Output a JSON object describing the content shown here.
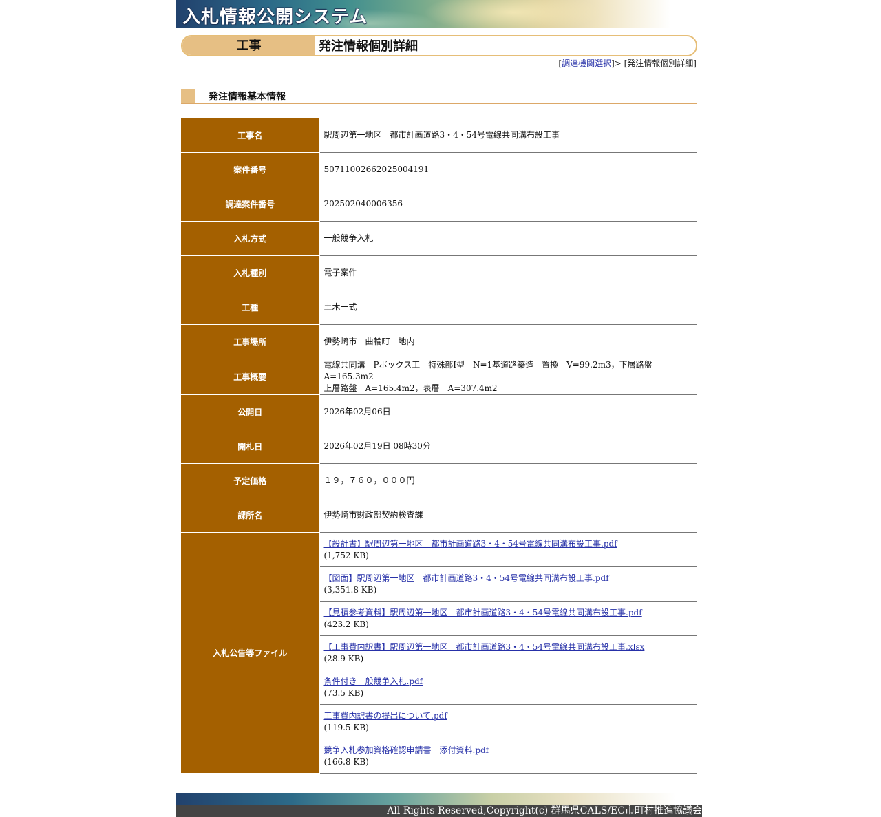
{
  "banner": {
    "title": "入札情報公開システム"
  },
  "heading": {
    "category": "工事",
    "title": "発注情報個別詳細"
  },
  "breadcrumb": {
    "open": "[",
    "link": "調達機関選択",
    "sep": "]> [発注情報個別詳細]"
  },
  "section": {
    "title": "発注情報基本情報"
  },
  "rows": [
    {
      "label": "工事名",
      "value": "駅周辺第一地区　都市計画道路3・4・54号電線共同溝布設工事"
    },
    {
      "label": "案件番号",
      "value": "50711002662025004191"
    },
    {
      "label": "調達案件番号",
      "value": "202502040006356"
    },
    {
      "label": "入札方式",
      "value": "一般競争入札"
    },
    {
      "label": "入札種別",
      "value": "電子案件"
    },
    {
      "label": "工種",
      "value": "土木一式"
    },
    {
      "label": "工事場所",
      "value": "伊勢崎市　曲輪町　地内"
    },
    {
      "label": "工事概要",
      "line1": "電線共同溝　Pボックス工　特殊部I型　N=1基道路築造　置換　V=99.2m3，下層路盤　A=165.3m2",
      "line2": "上層路盤　A=165.4m2，表層　A=307.4m2"
    },
    {
      "label": "公開日",
      "value": "2026年02月06日"
    },
    {
      "label": "開札日",
      "value": "2026年02月19日 08時30分"
    },
    {
      "label": "予定価格",
      "value": "１９，７６０，０００円"
    },
    {
      "label": "課所名",
      "value": "伊勢崎市財政部契約検査課"
    }
  ],
  "files_label": "入札公告等ファイル",
  "files": [
    {
      "name": "【設計書】駅周辺第一地区　都市計画道路3・4・54号電線共同溝布設工事.pdf",
      "size": "(1,752 KB)"
    },
    {
      "name": "【図面】駅周辺第一地区　都市計画道路3・4・54号電線共同溝布設工事.pdf",
      "size": "(3,351.8 KB)"
    },
    {
      "name": "【見積参考資料】駅周辺第一地区　都市計画道路3・4・54号電線共同溝布設工事.pdf",
      "size": "(423.2 KB)"
    },
    {
      "name": "【工事費内訳書】駅周辺第一地区　都市計画道路3・4・54号電線共同溝布設工事.xlsx",
      "size": "(28.9 KB)"
    },
    {
      "name": "条件付き一般競争入札.pdf",
      "size": "(73.5 KB)"
    },
    {
      "name": "工事費内訳書の提出について.pdf",
      "size": "(119.5 KB)"
    },
    {
      "name": "競争入札参加資格確認申請書　添付資料.pdf",
      "size": "(166.8 KB)"
    }
  ],
  "footer": {
    "copyright": "All Rights Reserved,Copyright(c) 群馬県CALS/EC市町村推進協議会"
  },
  "colors": {
    "header_cell": "#a46000",
    "accent": "#e6bf84",
    "link": "#2630a8"
  }
}
